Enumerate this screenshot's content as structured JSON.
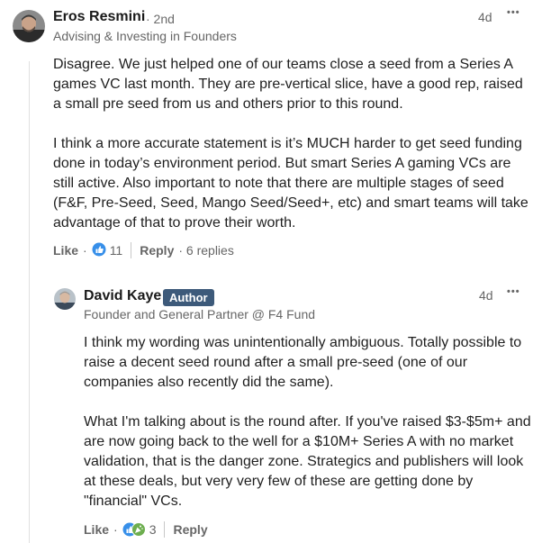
{
  "parent": {
    "author": "Eros Resmini",
    "degree": "· 2nd",
    "headline": "Advising & Investing in Founders",
    "time": "4d",
    "more": "•••",
    "paragraphs": [
      "Disagree. We just helped one of our teams close a seed from a Series A games VC last month. They are pre-vertical slice, have a good rep, raised a small pre seed from us and others prior to this round.",
      "I think a more accurate statement is it’s MUCH harder to get seed funding done in today’s environment period. But smart Series A gaming VCs are still active. Also important to note that there are multiple stages of seed (F&F, Pre-Seed, Seed, Mango Seed/Seed+, etc) and smart teams will take advantage of that to prove their worth."
    ],
    "like_label": "Like",
    "dot": "·",
    "reaction_count": "11",
    "reply_label": "Reply",
    "replies_text": "· 6 replies",
    "reaction_icon": "like-thumb-icon"
  },
  "reply": {
    "author": "David Kaye",
    "badge": "Author",
    "headline": "Founder and General Partner @ F4 Fund",
    "time": "4d",
    "more": "•••",
    "paragraphs": [
      "I think my wording was unintentionally ambiguous. Totally possible to raise a decent seed round after a small pre-seed (one of our companies also recently did the same).",
      "What I'm talking about is the round after. If you've raised $3-$5m+ and are now going back to the well for a $10M+ Series A with no market validation, that is the danger zone. Strategics and publishers will look at these deals, but very very few of these are getting done by \"financial\" VCs."
    ],
    "like_label": "Like",
    "dot": "·",
    "reaction_count": "3",
    "reply_label": "Reply",
    "reaction_icons": [
      "like-thumb-icon",
      "celebrate-icon"
    ]
  },
  "colors": {
    "like_blue": "#378fe9",
    "celebrate_green": "#44712e",
    "badge_bg": "#3d5a7a"
  }
}
